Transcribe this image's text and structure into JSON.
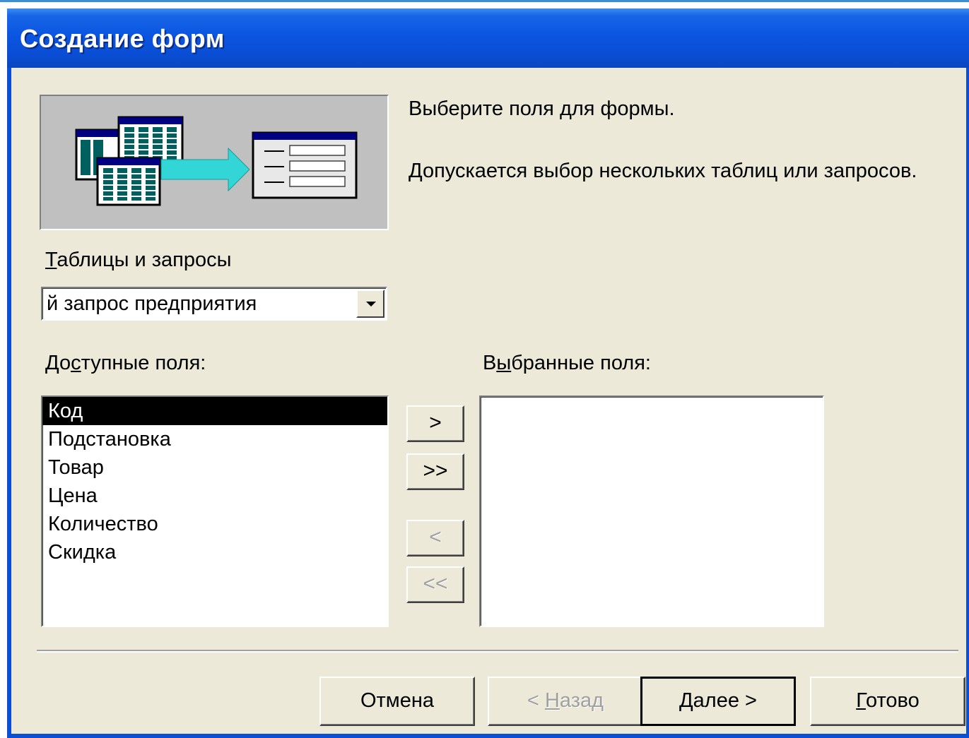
{
  "window": {
    "title": "Создание форм"
  },
  "description": {
    "line1": "Выберите поля для формы.",
    "line2": "Допускается выбор нескольких таблиц или запросов."
  },
  "tables_label": {
    "mnemonic": "Т",
    "rest": "аблицы и запросы"
  },
  "combo": {
    "value": "й запрос предприятия"
  },
  "available_label": {
    "pre": "До",
    "mnemonic": "с",
    "post": "тупные поля:"
  },
  "selected_label": {
    "pre": "В",
    "mnemonic": "ы",
    "post": "бранные поля:"
  },
  "available_fields": [
    {
      "label": "Код",
      "selected": true
    },
    {
      "label": "Подстановка"
    },
    {
      "label": "Товар"
    },
    {
      "label": "Цена"
    },
    {
      "label": "Количество"
    },
    {
      "label": "Скидка"
    }
  ],
  "move_buttons": {
    "add_one": ">",
    "add_all": ">>",
    "remove_one": "<",
    "remove_all": "<<"
  },
  "buttons": {
    "cancel": "Отмена",
    "back_pre": "< ",
    "back_mnemonic": "Н",
    "back_post": "азад",
    "next_mnemonic": "Д",
    "next_post": "алее >",
    "finish_mnemonic": "Г",
    "finish_post": "отово"
  },
  "icons": {
    "wizard_illustration": "tables-to-form-illustration",
    "combo_arrow": "chevron-down-icon"
  },
  "colors": {
    "title_bar": "#0a4fd6",
    "dialog_bg": "#ece9d8",
    "selection": "#000000",
    "illustration_arrow": "#33d6d6"
  }
}
